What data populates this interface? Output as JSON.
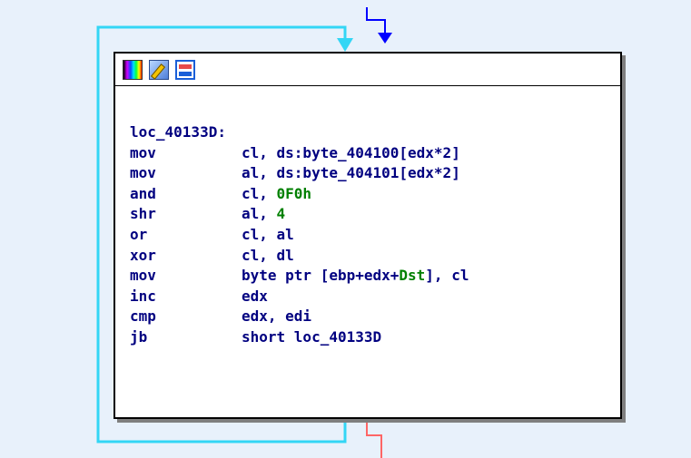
{
  "toolbar": {
    "icons": [
      "color-icon",
      "rename-icon",
      "group-nodes-icon"
    ]
  },
  "colors": {
    "background": "#e8f1fb",
    "loop_edge": "#33d6f5",
    "entry_edge": "#0000ff",
    "exit_edge": "#ff6666",
    "text": "#000080",
    "immediate": "#008000"
  },
  "block": {
    "label": "loc_40133D:",
    "instructions": [
      {
        "mnemonic": "mov",
        "operands": [
          {
            "text": "cl, ds:byte_404100[edx*2]"
          }
        ]
      },
      {
        "mnemonic": "mov",
        "operands": [
          {
            "text": "al, ds:byte_404101[edx*2]"
          }
        ]
      },
      {
        "mnemonic": "and",
        "operands": [
          {
            "text": "cl, "
          },
          {
            "text": "0F0h",
            "kind": "imm"
          }
        ]
      },
      {
        "mnemonic": "shr",
        "operands": [
          {
            "text": "al, "
          },
          {
            "text": "4",
            "kind": "imm"
          }
        ]
      },
      {
        "mnemonic": "or",
        "operands": [
          {
            "text": "cl, al"
          }
        ]
      },
      {
        "mnemonic": "xor",
        "operands": [
          {
            "text": "cl, dl"
          }
        ]
      },
      {
        "mnemonic": "mov",
        "operands": [
          {
            "text": "byte ptr [ebp+edx+"
          },
          {
            "text": "Dst",
            "kind": "imm"
          },
          {
            "text": "], cl"
          }
        ]
      },
      {
        "mnemonic": "inc",
        "operands": [
          {
            "text": "edx"
          }
        ]
      },
      {
        "mnemonic": "cmp",
        "operands": [
          {
            "text": "edx, edi"
          }
        ]
      },
      {
        "mnemonic": "jb",
        "operands": [
          {
            "text": "short loc_40133D"
          }
        ]
      }
    ]
  }
}
